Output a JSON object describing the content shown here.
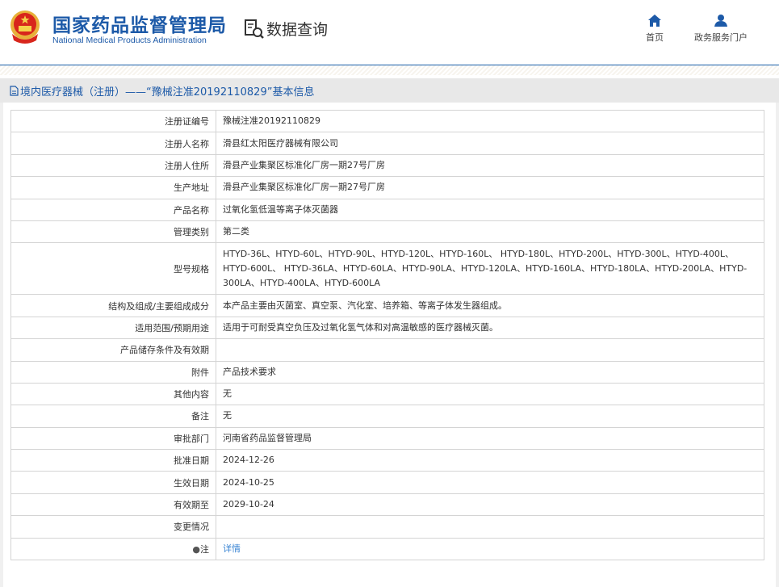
{
  "header": {
    "title_cn": "国家药品监督管理局",
    "title_en": "National Medical Products Administration",
    "query_label": "数据查询",
    "nav": [
      {
        "label": "首页",
        "icon": "home-icon"
      },
      {
        "label": "政务服务门户",
        "icon": "user-icon"
      }
    ]
  },
  "section_title": "境内医疗器械（注册）——“豫械注准20192110829”基本信息",
  "rows": [
    {
      "label": "注册证编号",
      "value": "豫械注准20192110829"
    },
    {
      "label": "注册人名称",
      "value": "滑县红太阳医疗器械有限公司"
    },
    {
      "label": "注册人住所",
      "value": "滑县产业集聚区标准化厂房一期27号厂房"
    },
    {
      "label": "生产地址",
      "value": "滑县产业集聚区标准化厂房一期27号厂房"
    },
    {
      "label": "产品名称",
      "value": "过氧化氢低温等离子体灭菌器"
    },
    {
      "label": "管理类别",
      "value": "第二类"
    },
    {
      "label": "型号规格",
      "value": "HTYD-36L、HTYD-60L、HTYD-90L、HTYD-120L、HTYD-160L、 HTYD-180L、HTYD-200L、HTYD-300L、HTYD-400L、HTYD-600L、 HTYD-36LA、HTYD-60LA、HTYD-90LA、HTYD-120LA、HTYD-160LA、HTYD-180LA、HTYD-200LA、HTYD-300LA、HTYD-400LA、HTYD-600LA"
    },
    {
      "label": "结构及组成/主要组成成分",
      "value": "本产品主要由灭菌室、真空泵、汽化室、培养箱、等离子体发生器组成。"
    },
    {
      "label": "适用范围/预期用途",
      "value": "适用于可耐受真空负压及过氧化氢气体和对高温敏感的医疗器械灭菌。"
    },
    {
      "label": "产品储存条件及有效期",
      "value": ""
    },
    {
      "label": "附件",
      "value": "产品技术要求"
    },
    {
      "label": "其他内容",
      "value": "无"
    },
    {
      "label": "备注",
      "value": "无"
    },
    {
      "label": "审批部门",
      "value": "河南省药品监督管理局"
    },
    {
      "label": "批准日期",
      "value": "2024-12-26"
    },
    {
      "label": "生效日期",
      "value": "2024-10-25"
    },
    {
      "label": "有效期至",
      "value": "2029-10-24"
    },
    {
      "label": "变更情况",
      "value": ""
    }
  ],
  "note": {
    "label": "注",
    "link": "详情"
  }
}
